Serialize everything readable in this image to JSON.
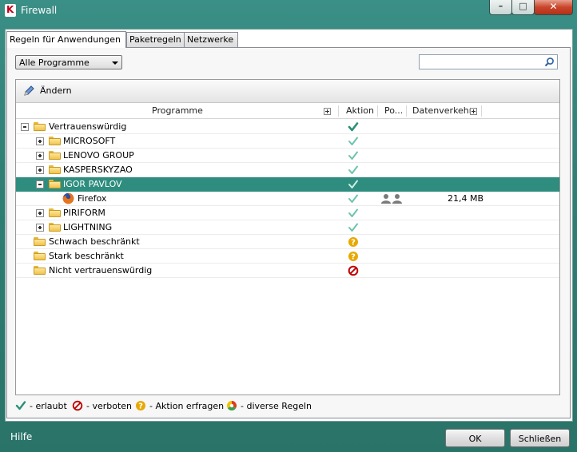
{
  "window": {
    "title": "Firewall"
  },
  "tabs": [
    {
      "label": "Regeln für Anwendungen"
    },
    {
      "label": "Paketregeln"
    },
    {
      "label": "Netzwerke"
    }
  ],
  "filter": {
    "selected": "Alle Programme",
    "search_value": ""
  },
  "toolbar": {
    "edit_label": "Ändern"
  },
  "columns": {
    "programs": "Programme",
    "action": "Aktion",
    "ports": "Po...",
    "traffic": "Datenverkehr"
  },
  "rows": [
    {
      "label": "Vertrauenswürdig",
      "action": "allow-strong"
    },
    {
      "label": "MICROSOFT",
      "action": "allow"
    },
    {
      "label": "LENOVO GROUP",
      "action": "allow"
    },
    {
      "label": "KASPERSKYZAO",
      "action": "allow"
    },
    {
      "label": "IGOR PAVLOV",
      "action": "allow"
    },
    {
      "label": "Firefox",
      "action": "allow",
      "traffic": "21,4 MB"
    },
    {
      "label": "PIRIFORM",
      "action": "allow"
    },
    {
      "label": "LIGHTNING",
      "action": "allow"
    },
    {
      "label": "Schwach beschränkt",
      "action": "ask"
    },
    {
      "label": "Stark beschränkt",
      "action": "ask"
    },
    {
      "label": "Nicht vertrauenswürdig",
      "action": "deny"
    }
  ],
  "legend": {
    "allowed": "- erlaubt",
    "denied": "- verboten",
    "ask": "- Aktion erfragen",
    "various": "- diverse Regeln"
  },
  "footer": {
    "help": "Hilfe",
    "ok": "OK",
    "close": "Schließen"
  },
  "colors": {
    "selection": "#2e8d7e",
    "allow": "#3aa08c",
    "ask": "#e8a800",
    "deny": "#c00000",
    "frame": "#2f7f74"
  }
}
